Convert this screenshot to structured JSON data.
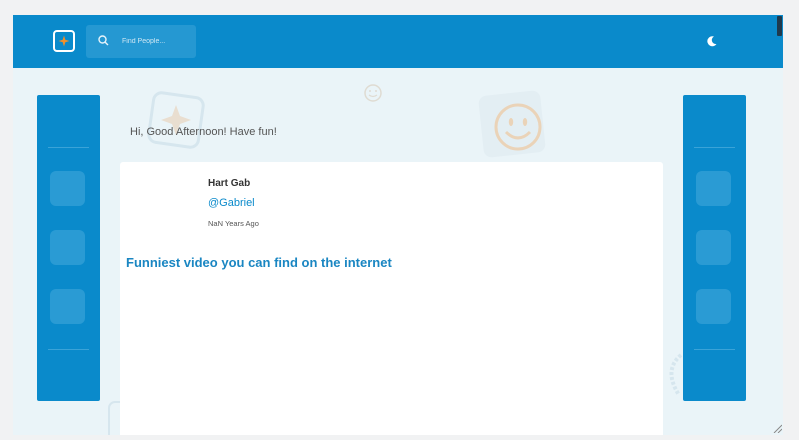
{
  "topbar": {
    "search": {
      "placeholder": "Find People...",
      "value": ""
    },
    "icons": {
      "logo": "sparkle-icon",
      "search": "search-icon",
      "theme_toggle": "moon-icon"
    }
  },
  "greeting": "Hi, Good Afternoon! Have fun!",
  "post": {
    "author_name": "Hart Gab",
    "handle": "@Gabriel",
    "time_ago": "NaN Years Ago",
    "title": "Funniest video you can find on the internet"
  },
  "colors": {
    "primary": "#0a8acb",
    "background": "#eaf4f8",
    "card": "#ffffff",
    "accent_orange": "#f0902a",
    "link": "#1a86c2"
  }
}
